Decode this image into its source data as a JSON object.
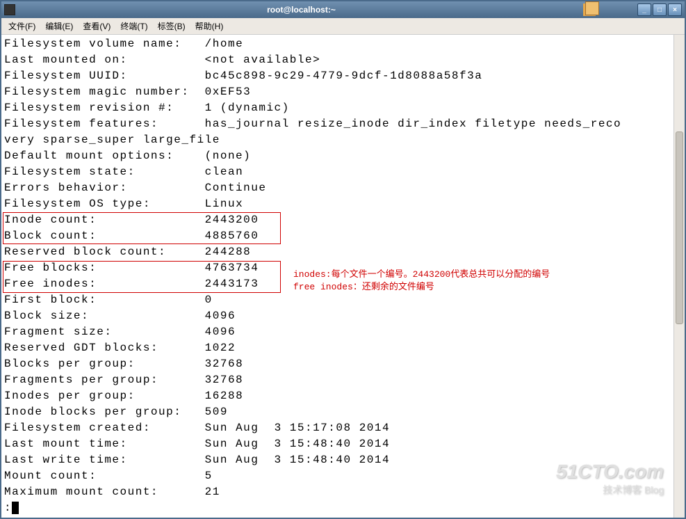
{
  "window": {
    "title": "root@localhost:~"
  },
  "menu": {
    "file": "文件(F)",
    "edit": "编辑(E)",
    "view": "查看(V)",
    "terminal": "终端(T)",
    "tabs": "标签(B)",
    "help": "帮助(H)"
  },
  "fs": {
    "volume_name_label": "Filesystem volume name:",
    "volume_name": "/home",
    "last_mounted_label": "Last mounted on:",
    "last_mounted": "<not available>",
    "uuid_label": "Filesystem UUID:",
    "uuid": "bc45c898-9c29-4779-9dcf-1d8088a58f3a",
    "magic_label": "Filesystem magic number:",
    "magic": "0xEF53",
    "revision_label": "Filesystem revision #:",
    "revision": "1 (dynamic)",
    "features_label": "Filesystem features:",
    "features": "has_journal resize_inode dir_index filetype needs_reco",
    "features_cont": "very sparse_super large_file",
    "mount_opts_label": "Default mount options:",
    "mount_opts": "(none)",
    "state_label": "Filesystem state:",
    "state": "clean",
    "errors_label": "Errors behavior:",
    "errors": "Continue",
    "os_type_label": "Filesystem OS type:",
    "os_type": "Linux",
    "inode_count_label": "Inode count:",
    "inode_count": "2443200",
    "block_count_label": "Block count:",
    "block_count": "4885760",
    "reserved_blocks_label": "Reserved block count:",
    "reserved_blocks": "244288",
    "free_blocks_label": "Free blocks:",
    "free_blocks": "4763734",
    "free_inodes_label": "Free inodes:",
    "free_inodes": "2443173",
    "first_block_label": "First block:",
    "first_block": "0",
    "block_size_label": "Block size:",
    "block_size": "4096",
    "fragment_size_label": "Fragment size:",
    "fragment_size": "4096",
    "reserved_gdt_label": "Reserved GDT blocks:",
    "reserved_gdt": "1022",
    "blocks_per_group_label": "Blocks per group:",
    "blocks_per_group": "32768",
    "fragments_per_group_label": "Fragments per group:",
    "fragments_per_group": "32768",
    "inodes_per_group_label": "Inodes per group:",
    "inodes_per_group": "16288",
    "inode_blocks_per_group_label": "Inode blocks per group:",
    "inode_blocks_per_group": "509",
    "created_label": "Filesystem created:",
    "created": "Sun Aug  3 15:17:08 2014",
    "last_mount_time_label": "Last mount time:",
    "last_mount_time": "Sun Aug  3 15:48:40 2014",
    "last_write_time_label": "Last write time:",
    "last_write_time": "Sun Aug  3 15:48:40 2014",
    "mount_count_label": "Mount count:",
    "mount_count": "5",
    "max_mount_count_label": "Maximum mount count:",
    "max_mount_count": "21",
    "prompt": ":"
  },
  "annotation": {
    "line1": "inodes:每个文件一个编号。2443200代表总共可以分配的编号",
    "line2": "free inodes：还剩余的文件编号"
  },
  "watermark": {
    "main": "51CTO.com",
    "sub": "技术博客   Blog"
  }
}
